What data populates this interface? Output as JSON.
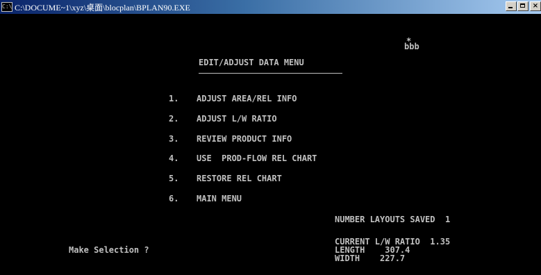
{
  "window": {
    "title": "C:\\DOCUME~1\\xyz\\桌面\\blocplan\\BPLAN90.EXE",
    "icon": "console-icon",
    "minimize_label": "",
    "maximize_label": "",
    "close_label": "×"
  },
  "screen": {
    "star": "*",
    "user": "bbb",
    "menu_title": "EDIT/ADJUST DATA MENU",
    "items": [
      {
        "number": "1.",
        "label": "ADJUST AREA/REL INFO"
      },
      {
        "number": "2.",
        "label": "ADJUST L/W RATIO"
      },
      {
        "number": "3.",
        "label": "REVIEW PRODUCT INFO"
      },
      {
        "number": "4.",
        "label": "USE  PROD-FLOW REL CHART"
      },
      {
        "number": "5.",
        "label": "RESTORE REL CHART"
      },
      {
        "number": "6.",
        "label": "MAIN MENU"
      }
    ],
    "layouts_saved": "NUMBER LAYOUTS SAVED  1",
    "prompt": "Make Selection ?",
    "ratio_line": "CURRENT L/W RATIO  1.35",
    "length_line": "LENGTH    307.4",
    "width_line": "WIDTH    227.7"
  },
  "colors": {
    "background": "#000000",
    "text": "#c0c0c0",
    "titlebar_start": "#0a246a",
    "titlebar_end": "#a6caf0"
  }
}
